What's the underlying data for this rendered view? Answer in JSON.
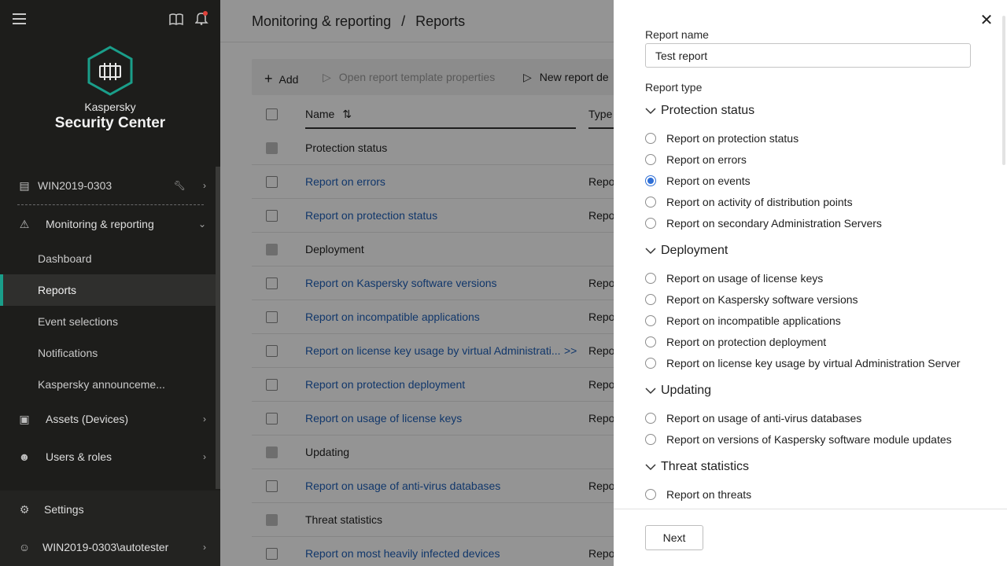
{
  "sidebar": {
    "brand_line1": "Kaspersky",
    "brand_line2": "Security Center",
    "server": "WIN2019-0303",
    "section": "Monitoring & reporting",
    "sub_items": [
      "Dashboard",
      "Reports",
      "Event selections",
      "Notifications",
      "Kaspersky announceme..."
    ],
    "active_item": "Reports",
    "assets": "Assets (Devices)",
    "users": "Users & roles",
    "settings": "Settings",
    "account": "WIN2019-0303\\autotester",
    "accent_color": "#1a9e8a"
  },
  "main": {
    "breadcrumb_parent": "Monitoring & reporting",
    "breadcrumb_sep": "/",
    "breadcrumb_current": "Reports",
    "toolbar": {
      "add": "Add",
      "open_props": "Open report template properties",
      "new_report": "New report de"
    },
    "table": {
      "col_name": "Name",
      "col_type": "Type",
      "rows": [
        {
          "name": "Protection status",
          "type": "",
          "group": true
        },
        {
          "name": "Report on errors",
          "type": "Repo",
          "group": false
        },
        {
          "name": "Report on protection status",
          "type": "Repo",
          "group": false
        },
        {
          "name": "Deployment",
          "type": "",
          "group": true
        },
        {
          "name": "Report on Kaspersky software versions",
          "type": "Repo",
          "group": false
        },
        {
          "name": "Report on incompatible applications",
          "type": "Repo",
          "group": false
        },
        {
          "name": "Report on license key usage by virtual Administrati...",
          "type": "Repo",
          "group": false,
          "more": ">>"
        },
        {
          "name": "Report on protection deployment",
          "type": "Repo",
          "group": false
        },
        {
          "name": "Report on usage of license keys",
          "type": "Repo",
          "group": false
        },
        {
          "name": "Updating",
          "type": "",
          "group": true
        },
        {
          "name": "Report on usage of anti-virus databases",
          "type": "Repo",
          "group": false
        },
        {
          "name": "Threat statistics",
          "type": "",
          "group": true
        },
        {
          "name": "Report on most heavily infected devices",
          "type": "Repo",
          "group": false
        }
      ]
    }
  },
  "drawer": {
    "report_name_label": "Report name",
    "report_name_value": "Test report",
    "report_type_label": "Report type",
    "groups": [
      {
        "title": "Protection status",
        "options": [
          "Report on protection status",
          "Report on errors",
          "Report on events",
          "Report on activity of distribution points",
          "Report on secondary Administration Servers"
        ]
      },
      {
        "title": "Deployment",
        "options": [
          "Report on usage of license keys",
          "Report on Kaspersky software versions",
          "Report on incompatible applications",
          "Report on protection deployment",
          "Report on license key usage by virtual Administration Server"
        ]
      },
      {
        "title": "Updating",
        "options": [
          "Report on usage of anti-virus databases",
          "Report on versions of Kaspersky software module updates"
        ]
      },
      {
        "title": "Threat statistics",
        "options": [
          "Report on threats"
        ]
      }
    ],
    "selected_option": "Report on events",
    "next_label": "Next",
    "radio_color": "#2f6fd6"
  }
}
